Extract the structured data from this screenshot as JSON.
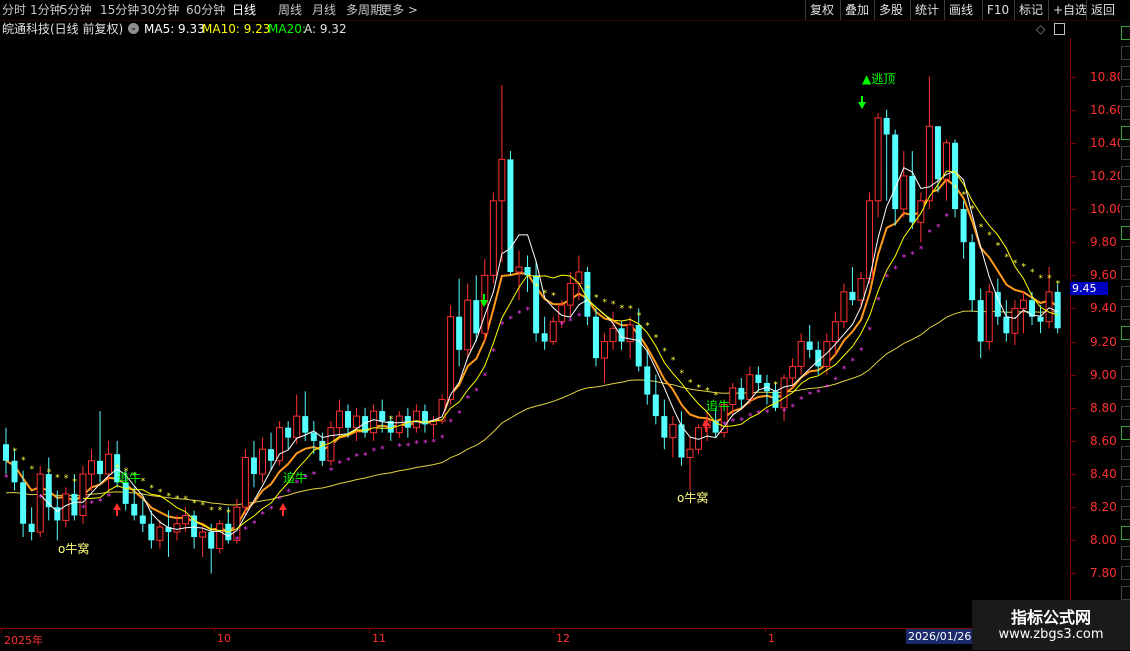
{
  "toolbar": {
    "periods": [
      "分时",
      "1分钟",
      "5分钟",
      "15分钟",
      "30分钟",
      "60分钟",
      "日线",
      "周线",
      "月线",
      "多周期",
      "更多 >"
    ],
    "active_period": "日线",
    "right_buttons": [
      "复权",
      "叠加",
      "多股",
      "统计",
      "画线",
      "F10",
      "标记",
      "+自选",
      "返回"
    ]
  },
  "info": {
    "stock_title": "皖通科技(日线 前复权)",
    "ma5": "MA5: 9.33",
    "ma10": "MA10: 9.23",
    "ma20": "MA20:",
    "a": "A: 9.32"
  },
  "price_axis": {
    "labels": [
      "10.80",
      "10.60",
      "10.40",
      "10.20",
      "10.00",
      "9.80",
      "9.60",
      "9.40",
      "9.20",
      "9.00",
      "8.80",
      "8.60",
      "8.40",
      "8.20",
      "8.00",
      "7.80"
    ],
    "current": "9.45"
  },
  "time_axis": {
    "labels": [
      "2025年",
      "10",
      "11",
      "12",
      "1"
    ],
    "hover_date": "2026/01/26"
  },
  "annotations": {
    "top_escape": "▲逃顶",
    "bull_nest_1": "o牛窝",
    "bull_nest_2": "o牛窝",
    "chase_1": "追牛",
    "chase_2": "追牛",
    "chase_3": "追牛"
  },
  "watermark": {
    "line1": "指标公式网",
    "line2": "www.zbgs3.com"
  },
  "colors": {
    "up": "#ff3030",
    "down": "#54ffff",
    "ma5": "#ffffff",
    "ma10": "#ffff00",
    "ma20": "#ff00ff",
    "orange_line": "#ff9a1a",
    "yellow_line": "#e0d040",
    "accent_green": "#00ff00"
  },
  "chart_data": {
    "type": "candlestick",
    "ylim": [
      7.7,
      10.9
    ],
    "candles": [
      [
        8.58,
        8.68,
        8.4,
        8.48
      ],
      [
        8.48,
        8.55,
        8.3,
        8.35
      ],
      [
        8.35,
        8.42,
        8.02,
        8.1
      ],
      [
        8.1,
        8.2,
        8.0,
        8.05
      ],
      [
        8.05,
        8.45,
        8.02,
        8.4
      ],
      [
        8.4,
        8.5,
        8.12,
        8.2
      ],
      [
        8.2,
        8.3,
        8.0,
        8.12
      ],
      [
        8.12,
        8.32,
        8.08,
        8.28
      ],
      [
        8.28,
        8.4,
        8.12,
        8.15
      ],
      [
        8.15,
        8.45,
        8.1,
        8.4
      ],
      [
        8.4,
        8.55,
        8.3,
        8.48
      ],
      [
        8.48,
        8.78,
        8.35,
        8.4
      ],
      [
        8.4,
        8.6,
        8.3,
        8.52
      ],
      [
        8.52,
        8.6,
        8.32,
        8.35
      ],
      [
        8.35,
        8.42,
        8.18,
        8.22
      ],
      [
        8.22,
        8.32,
        8.12,
        8.15
      ],
      [
        8.15,
        8.25,
        8.05,
        8.1
      ],
      [
        8.1,
        8.18,
        7.95,
        8.0
      ],
      [
        8.0,
        8.12,
        7.95,
        8.08
      ],
      [
        8.08,
        8.18,
        7.9,
        8.05
      ],
      [
        8.05,
        8.15,
        8.0,
        8.1
      ],
      [
        8.1,
        8.2,
        8.05,
        8.15
      ],
      [
        8.15,
        8.18,
        7.95,
        8.02
      ],
      [
        8.02,
        8.1,
        7.9,
        8.05
      ],
      [
        8.05,
        8.1,
        7.8,
        7.95
      ],
      [
        7.95,
        8.12,
        7.92,
        8.1
      ],
      [
        8.1,
        8.2,
        7.98,
        8.0
      ],
      [
        8.0,
        8.25,
        7.98,
        8.2
      ],
      [
        8.2,
        8.55,
        8.15,
        8.5
      ],
      [
        8.5,
        8.6,
        8.32,
        8.4
      ],
      [
        8.4,
        8.62,
        8.35,
        8.55
      ],
      [
        8.55,
        8.65,
        8.42,
        8.48
      ],
      [
        8.48,
        8.72,
        8.45,
        8.68
      ],
      [
        8.68,
        8.72,
        8.55,
        8.62
      ],
      [
        8.62,
        8.88,
        8.58,
        8.75
      ],
      [
        8.75,
        8.9,
        8.6,
        8.65
      ],
      [
        8.65,
        8.72,
        8.52,
        8.6
      ],
      [
        8.6,
        8.65,
        8.45,
        8.48
      ],
      [
        8.48,
        8.72,
        8.45,
        8.68
      ],
      [
        8.68,
        8.85,
        8.62,
        8.78
      ],
      [
        8.78,
        8.82,
        8.62,
        8.68
      ],
      [
        8.68,
        8.8,
        8.6,
        8.75
      ],
      [
        8.75,
        8.8,
        8.62,
        8.65
      ],
      [
        8.65,
        8.82,
        8.6,
        8.78
      ],
      [
        8.78,
        8.85,
        8.65,
        8.72
      ],
      [
        8.72,
        8.75,
        8.6,
        8.65
      ],
      [
        8.65,
        8.78,
        8.62,
        8.75
      ],
      [
        8.75,
        8.8,
        8.62,
        8.68
      ],
      [
        8.68,
        8.82,
        8.65,
        8.78
      ],
      [
        8.78,
        8.82,
        8.65,
        8.7
      ],
      [
        8.7,
        8.75,
        8.62,
        8.72
      ],
      [
        8.72,
        8.88,
        8.7,
        8.85
      ],
      [
        8.85,
        9.42,
        8.82,
        9.35
      ],
      [
        9.35,
        9.58,
        9.05,
        9.15
      ],
      [
        9.15,
        9.55,
        9.1,
        9.45
      ],
      [
        9.45,
        9.6,
        9.2,
        9.25
      ],
      [
        9.25,
        9.7,
        9.2,
        9.6
      ],
      [
        9.6,
        10.1,
        9.55,
        10.05
      ],
      [
        10.05,
        10.75,
        9.68,
        10.3
      ],
      [
        10.3,
        10.35,
        9.6,
        9.62
      ],
      [
        9.62,
        9.75,
        9.45,
        9.65
      ],
      [
        9.65,
        9.72,
        9.5,
        9.6
      ],
      [
        9.6,
        9.68,
        9.2,
        9.25
      ],
      [
        9.25,
        9.35,
        9.15,
        9.2
      ],
      [
        9.2,
        9.35,
        9.18,
        9.32
      ],
      [
        9.32,
        9.45,
        9.28,
        9.42
      ],
      [
        9.42,
        9.62,
        9.35,
        9.55
      ],
      [
        9.55,
        9.72,
        9.45,
        9.62
      ],
      [
        9.62,
        9.65,
        9.3,
        9.35
      ],
      [
        9.35,
        9.4,
        9.05,
        9.1
      ],
      [
        9.1,
        9.25,
        8.95,
        9.2
      ],
      [
        9.2,
        9.38,
        9.15,
        9.28
      ],
      [
        9.28,
        9.32,
        9.15,
        9.2
      ],
      [
        9.2,
        9.35,
        9.1,
        9.3
      ],
      [
        9.3,
        9.4,
        9.02,
        9.05
      ],
      [
        9.05,
        9.15,
        8.82,
        8.88
      ],
      [
        8.88,
        9.0,
        8.7,
        8.75
      ],
      [
        8.75,
        8.85,
        8.55,
        8.62
      ],
      [
        8.62,
        8.75,
        8.5,
        8.7
      ],
      [
        8.7,
        8.78,
        8.45,
        8.5
      ],
      [
        8.5,
        8.62,
        8.3,
        8.55
      ],
      [
        8.55,
        8.7,
        8.52,
        8.68
      ],
      [
        8.68,
        8.78,
        8.6,
        8.72
      ],
      [
        8.72,
        8.8,
        8.62,
        8.65
      ],
      [
        8.65,
        8.85,
        8.62,
        8.82
      ],
      [
        8.82,
        8.95,
        8.75,
        8.92
      ],
      [
        8.92,
        8.98,
        8.8,
        8.85
      ],
      [
        8.85,
        9.05,
        8.82,
        9.0
      ],
      [
        9.0,
        9.05,
        8.9,
        8.95
      ],
      [
        8.95,
        9.0,
        8.82,
        8.9
      ],
      [
        8.9,
        8.95,
        8.78,
        8.8
      ],
      [
        8.8,
        9.0,
        8.72,
        8.98
      ],
      [
        8.98,
        9.1,
        8.92,
        9.05
      ],
      [
        9.05,
        9.25,
        9.0,
        9.2
      ],
      [
        9.2,
        9.3,
        9.1,
        9.15
      ],
      [
        9.15,
        9.2,
        9.0,
        9.05
      ],
      [
        9.05,
        9.25,
        9.0,
        9.2
      ],
      [
        9.2,
        9.38,
        9.12,
        9.32
      ],
      [
        9.32,
        9.55,
        9.28,
        9.5
      ],
      [
        9.5,
        9.65,
        9.42,
        9.45
      ],
      [
        9.45,
        9.62,
        9.4,
        9.58
      ],
      [
        9.58,
        10.1,
        9.55,
        10.05
      ],
      [
        10.05,
        10.58,
        9.95,
        10.55
      ],
      [
        10.55,
        10.6,
        10.05,
        10.45
      ],
      [
        10.45,
        10.48,
        9.9,
        10.0
      ],
      [
        10.0,
        10.35,
        9.95,
        10.2
      ],
      [
        10.2,
        10.35,
        9.88,
        9.92
      ],
      [
        9.92,
        10.1,
        9.8,
        10.05
      ],
      [
        10.05,
        10.8,
        10.0,
        10.5
      ],
      [
        10.5,
        10.5,
        10.1,
        10.18
      ],
      [
        10.18,
        10.42,
        10.05,
        10.4
      ],
      [
        10.4,
        10.42,
        9.95,
        10.0
      ],
      [
        10.0,
        10.05,
        9.7,
        9.8
      ],
      [
        9.8,
        9.85,
        9.38,
        9.45
      ],
      [
        9.45,
        9.52,
        9.1,
        9.2
      ],
      [
        9.2,
        9.55,
        9.15,
        9.5
      ],
      [
        9.5,
        9.58,
        9.3,
        9.35
      ],
      [
        9.35,
        9.45,
        9.2,
        9.25
      ],
      [
        9.25,
        9.45,
        9.18,
        9.4
      ],
      [
        9.4,
        9.5,
        9.25,
        9.45
      ],
      [
        9.45,
        9.5,
        9.3,
        9.35
      ],
      [
        9.35,
        9.42,
        9.25,
        9.32
      ],
      [
        9.32,
        9.65,
        9.28,
        9.5
      ],
      [
        9.5,
        9.55,
        9.25,
        9.28
      ]
    ]
  }
}
